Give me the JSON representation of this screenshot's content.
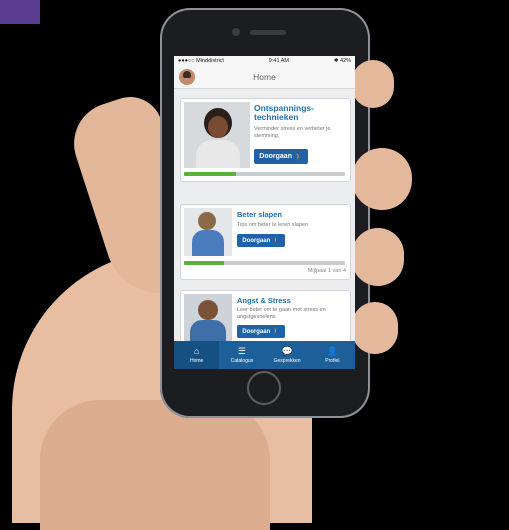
{
  "status": {
    "carrier": "●●●○○ Minddistrict",
    "time": "9:41 AM",
    "battery": "✱ 42%"
  },
  "nav": {
    "title": "Home"
  },
  "cards": [
    {
      "title": "Ontspannings-technieken",
      "description": "Verminder stress en verbeter je stemming.",
      "button": "Doorgaan",
      "progress": 0.32
    },
    {
      "title": "Beter slapen",
      "description": "Tips om beter te leren slapen",
      "button": "Doorgaan",
      "progress": 0.25,
      "milestone": "Mijlpaal 1 van 4"
    },
    {
      "title": "Angst & Stress",
      "description": "Leer beter om te gaan met stress en angstgevoelens",
      "button": "Doorgaan"
    }
  ],
  "tabs": [
    {
      "label": "Home",
      "icon": "home-icon",
      "glyph": "⌂"
    },
    {
      "label": "Catalogus",
      "icon": "list-icon",
      "glyph": "☰"
    },
    {
      "label": "Gesprekken",
      "icon": "chat-icon",
      "glyph": "💬"
    },
    {
      "label": "Profiel",
      "icon": "user-icon",
      "glyph": "👤"
    }
  ],
  "colors": {
    "accent": "#1f62a7",
    "progress": "#5bb13a",
    "tabbar": "#1d5f99"
  }
}
